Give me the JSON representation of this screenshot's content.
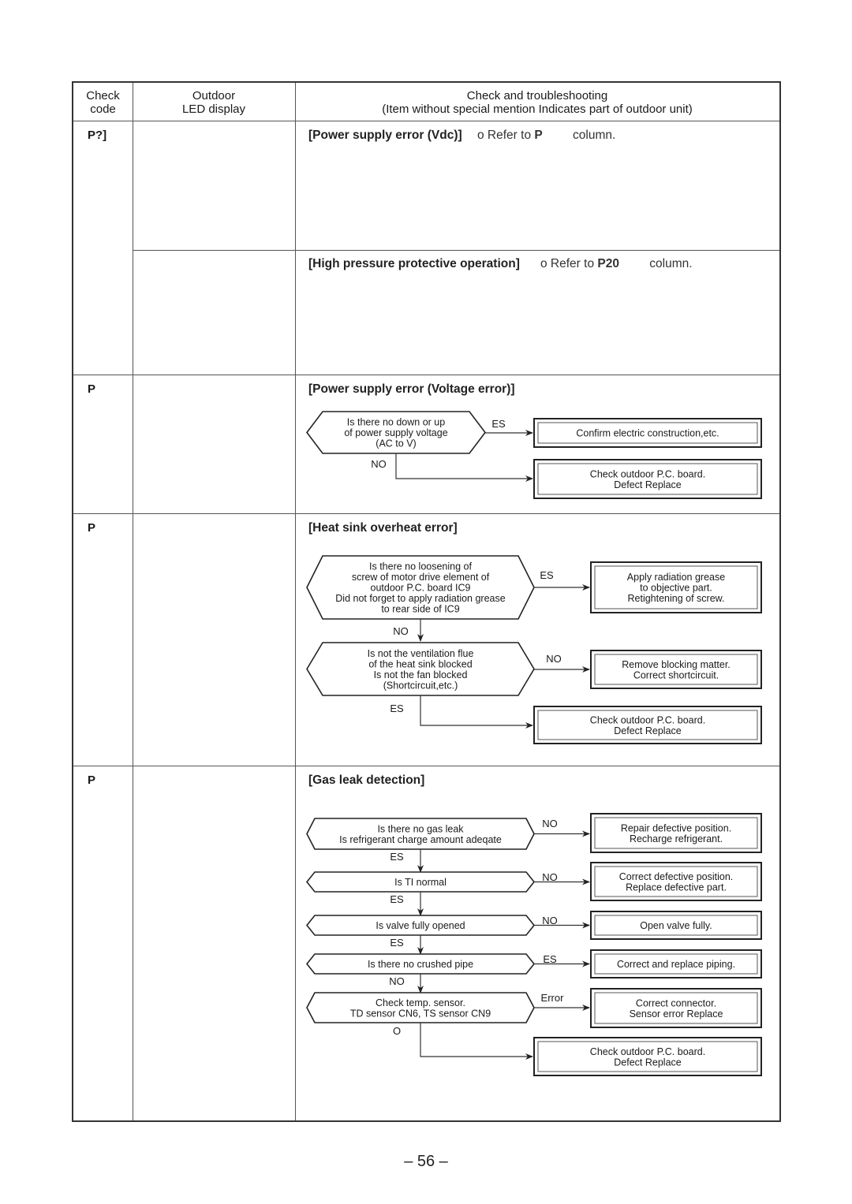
{
  "header": {
    "col1": [
      "Check",
      "code"
    ],
    "col2": [
      "Outdoor",
      "LED display"
    ],
    "col3": [
      "Check and troubleshooting",
      "(Item without special mention Indicates part of outdoor unit)"
    ]
  },
  "rows": [
    {
      "code": "P?]",
      "title": "[Power supply error (Vdc)]",
      "ref_prefix": "o Refer to",
      "ref_code": "P",
      "ref_suffix": "column."
    },
    {
      "code": "",
      "title": "[High pressure protective operation]",
      "ref_prefix": "o Refer to",
      "ref_code": "P20",
      "ref_suffix": "column."
    },
    {
      "code": "P",
      "title": "[Power supply error (Voltage error)]",
      "flow": {
        "q1": [
          "Is there no down or up",
          "of power supply voltage",
          "(AC to V)"
        ],
        "yes_label": "ES",
        "no_label": "NO",
        "a_yes": [
          "Confirm electric construction,etc."
        ],
        "a_no": [
          "Check outdoor P.C. board.",
          "Defect    Replace"
        ]
      }
    },
    {
      "code": "P",
      "title": "[Heat sink overheat error]",
      "flow": {
        "q1": [
          "Is there no loosening of",
          "screw of motor drive element of",
          "outdoor P.C. board IC9",
          "Did not forget to apply radiation grease",
          "to rear side of IC9"
        ],
        "q1_yes_label": "ES",
        "q1_yes": [
          "Apply radiation grease",
          "to objective part.",
          "Retightening of screw."
        ],
        "q1_no_label": "NO",
        "q2": [
          "Is not the ventilation flue",
          "of the heat sink blocked",
          "Is not the fan blocked",
          "(Shortcircuit,etc.)"
        ],
        "q2_no_label": "NO",
        "q2_no": [
          "Remove blocking matter.",
          "Correct shortcircuit."
        ],
        "q2_yes_label": "ES",
        "q2_yes": [
          "Check outdoor P.C. board.",
          "Defect    Replace"
        ]
      }
    },
    {
      "code": "P",
      "title": "[Gas leak detection]",
      "flow": {
        "steps": [
          {
            "q": [
              "Is there no gas leak",
              "Is refrigerant charge amount adeqate"
            ],
            "side_label": "NO",
            "a": [
              "Repair defective position.",
              "Recharge refrigerant."
            ],
            "down_label": "ES"
          },
          {
            "q": [
              "Is TI normal"
            ],
            "side_label": "NO",
            "a": [
              "Correct defective position.",
              "Replace defective part."
            ],
            "down_label": "ES"
          },
          {
            "q": [
              "Is valve fully opened"
            ],
            "side_label": "NO",
            "a": [
              "Open valve fully."
            ],
            "down_label": "ES"
          },
          {
            "q": [
              "Is there no crushed pipe"
            ],
            "side_label": "ES",
            "a": [
              "Correct and replace piping."
            ],
            "down_label": "NO"
          },
          {
            "q": [
              "Check temp. sensor.",
              "TD sensor CN6, TS sensor CN9"
            ],
            "side_label": "Error",
            "a": [
              "Correct connector.",
              "Sensor error    Replace"
            ],
            "down_label": "O"
          }
        ],
        "final": [
          "Check outdoor P.C. board.",
          "Defect    Replace"
        ]
      }
    }
  ],
  "page_number": "– 56 –"
}
